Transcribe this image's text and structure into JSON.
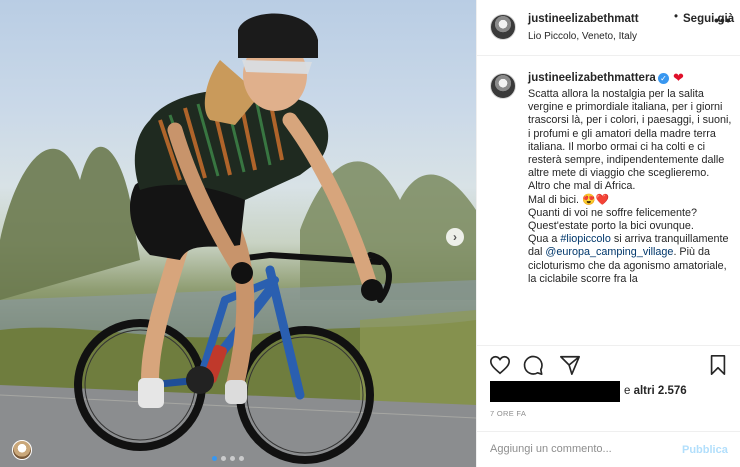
{
  "post": {
    "username": "justineelizabethmatt",
    "separator": "•",
    "follow_label": "Segui già",
    "location": "Lio Piccolo, Veneto, Italy",
    "more_icon": "more-options-icon"
  },
  "caption": {
    "username": "justineelizabethmattera",
    "verified_icon": "verified-badge-icon",
    "heart_icon": "red-heart-icon",
    "lines": [
      "Scatta allora la nostalgia per la salita vergine e primordiale italiana, per i giorni trascorsi là, per i colori, i paesaggi, i suoni, i profumi e gli amatori della madre terra italiana. Il morbo ormai ci ha colti e ci resterà sempre, indipendentemente dalle altre mete di viaggio che sceglieremo.",
      "Altro che mal di Africa.",
      "Mal di bici. 😍❤️",
      "Quanti di voi ne soffre felicemente? Quest'estate porto la bici ovunque.",
      "Qua a ",
      "#liopiccolo",
      " si arriva tranquillamente dal ",
      "@europa_camping_village",
      ". Più da cicloturismo che da agonismo amatoriale, la ciclabile scorre fra la"
    ]
  },
  "actions": {
    "like_icon": "heart-outline-icon",
    "comment_icon": "comment-icon",
    "share_icon": "send-icon",
    "save_icon": "bookmark-icon"
  },
  "likes": {
    "prefix": "e ",
    "others_label": "altri 2.576"
  },
  "timestamp": "7 ORE FA",
  "comment": {
    "placeholder": "Aggiungi un commento...",
    "publish_label": "Pubblica"
  },
  "photo": {
    "next_icon": "chevron-right-icon",
    "carousel_total": 4,
    "carousel_active": 1
  },
  "colors": {
    "accent": "#3897f0",
    "link": "#00376b",
    "heart": "#e0102a",
    "publish_disabled": "#b2dffc"
  }
}
